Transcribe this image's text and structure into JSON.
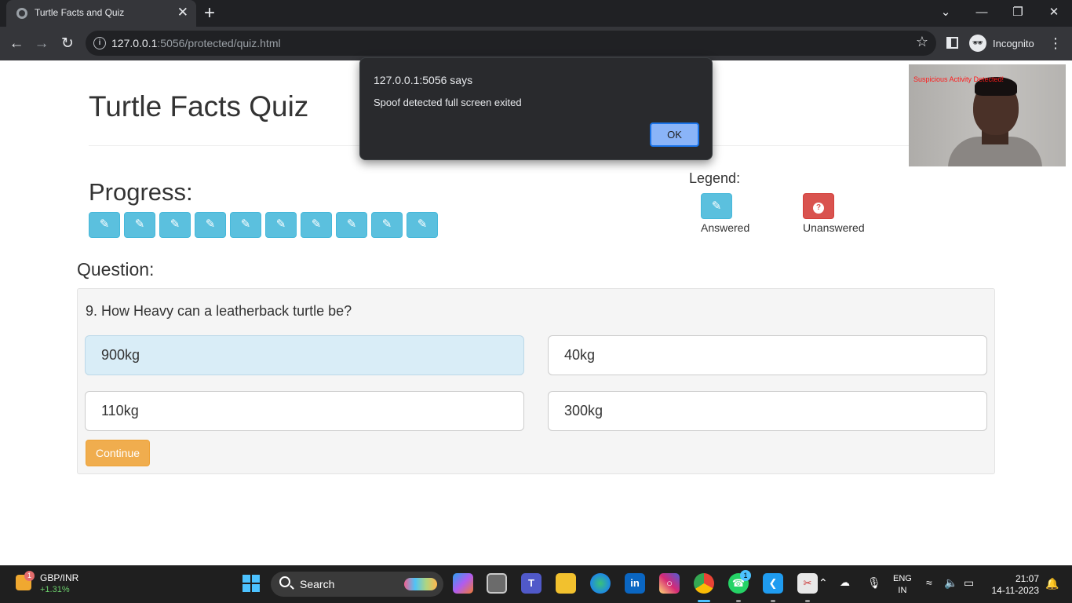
{
  "browser": {
    "tab_title": "Turtle Facts and Quiz",
    "tab_close": "✕",
    "new_tab": "+",
    "url_host": "127.0.0.1",
    "url_rest": ":5056/protected/quiz.html",
    "profile_label": "Incognito",
    "window_controls": [
      "⌄",
      "—",
      "❐",
      "✕"
    ]
  },
  "page": {
    "title": "Turtle Facts Quiz",
    "progress_title": "Progress:",
    "progress_count": 10,
    "progress_icon": "pencil-icon",
    "legend": {
      "title": "Legend:",
      "answered_label": "Answered",
      "unanswered_label": "Unanswered"
    },
    "question_heading": "Question:",
    "question_text": "9. How Heavy can a leatherback turtle be?",
    "options": [
      "900kg",
      "40kg",
      "110kg",
      "300kg"
    ],
    "selected_option": "900kg",
    "continue_label": "Continue"
  },
  "webcam": {
    "alert_text": "Suspicious Activity Detected!"
  },
  "dialog": {
    "title": "127.0.0.1:5056 says",
    "message": "Spoof detected full screen exited",
    "ok_label": "OK"
  },
  "taskbar": {
    "widget_badge": "1",
    "ticker_label": "GBP/INR",
    "ticker_change": "+1.31%",
    "search_label": "Search",
    "whatsapp_badge": "1",
    "language_line1": "ENG",
    "language_line2": "IN",
    "time": "21:07",
    "date": "14-11-2023"
  },
  "colors": {
    "answered": "#5bc0de",
    "unanswered": "#d9534f",
    "selected_option_bg": "#d9edf7",
    "continue": "#f0ad4e",
    "dialog_ok": "#8ab4f8"
  }
}
